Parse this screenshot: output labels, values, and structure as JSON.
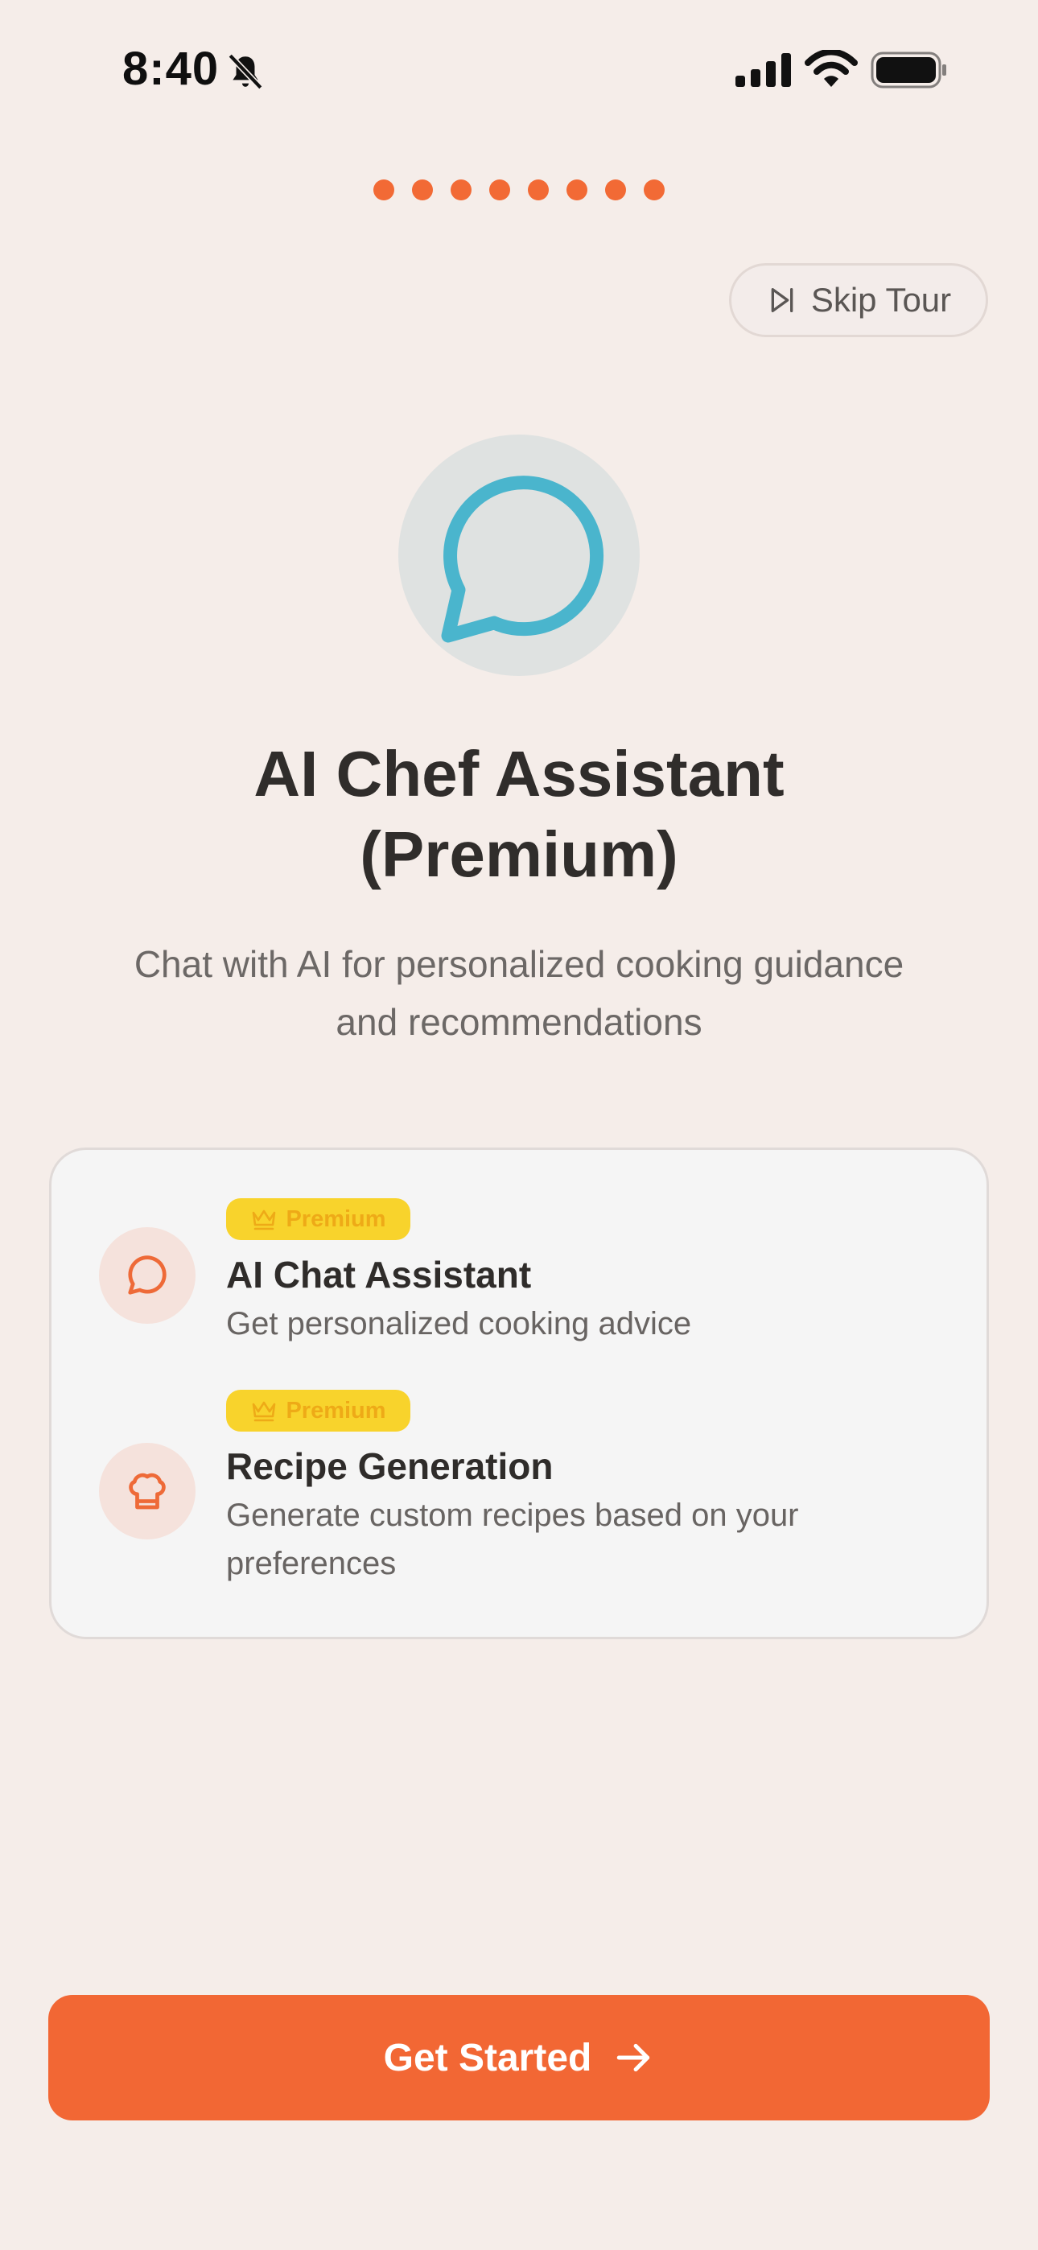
{
  "status_bar": {
    "time": "8:40",
    "icons": [
      "bell-slash-icon",
      "signal-icon",
      "wifi-icon",
      "battery-icon"
    ]
  },
  "progress": {
    "total_steps": 8
  },
  "skip": {
    "label": "Skip Tour",
    "icon": "skip-forward-icon"
  },
  "hero": {
    "icon": "chat-bubble-icon",
    "icon_color": "#4ab5cd",
    "title_line1": "AI Chef Assistant",
    "title_line2": "(Premium)",
    "subtitle_line1": "Chat with AI for personalized cooking guidance",
    "subtitle_line2": "and recommendations"
  },
  "features": [
    {
      "badge": "Premium",
      "title": "AI Chat Assistant",
      "description": "Get personalized cooking advice",
      "icon": "chat-bubble-icon"
    },
    {
      "badge": "Premium",
      "title": "Recipe Generation",
      "description_line1": "Generate custom recipes based on your",
      "description_line2": "preferences",
      "icon": "chef-hat-icon"
    }
  ],
  "cta": {
    "label": "Get Started",
    "icon": "arrow-right-icon"
  },
  "colors": {
    "accent": "#f26734",
    "badge": "#f8d32c",
    "badge_text": "#eeaa17",
    "background": "#f5ede9"
  }
}
